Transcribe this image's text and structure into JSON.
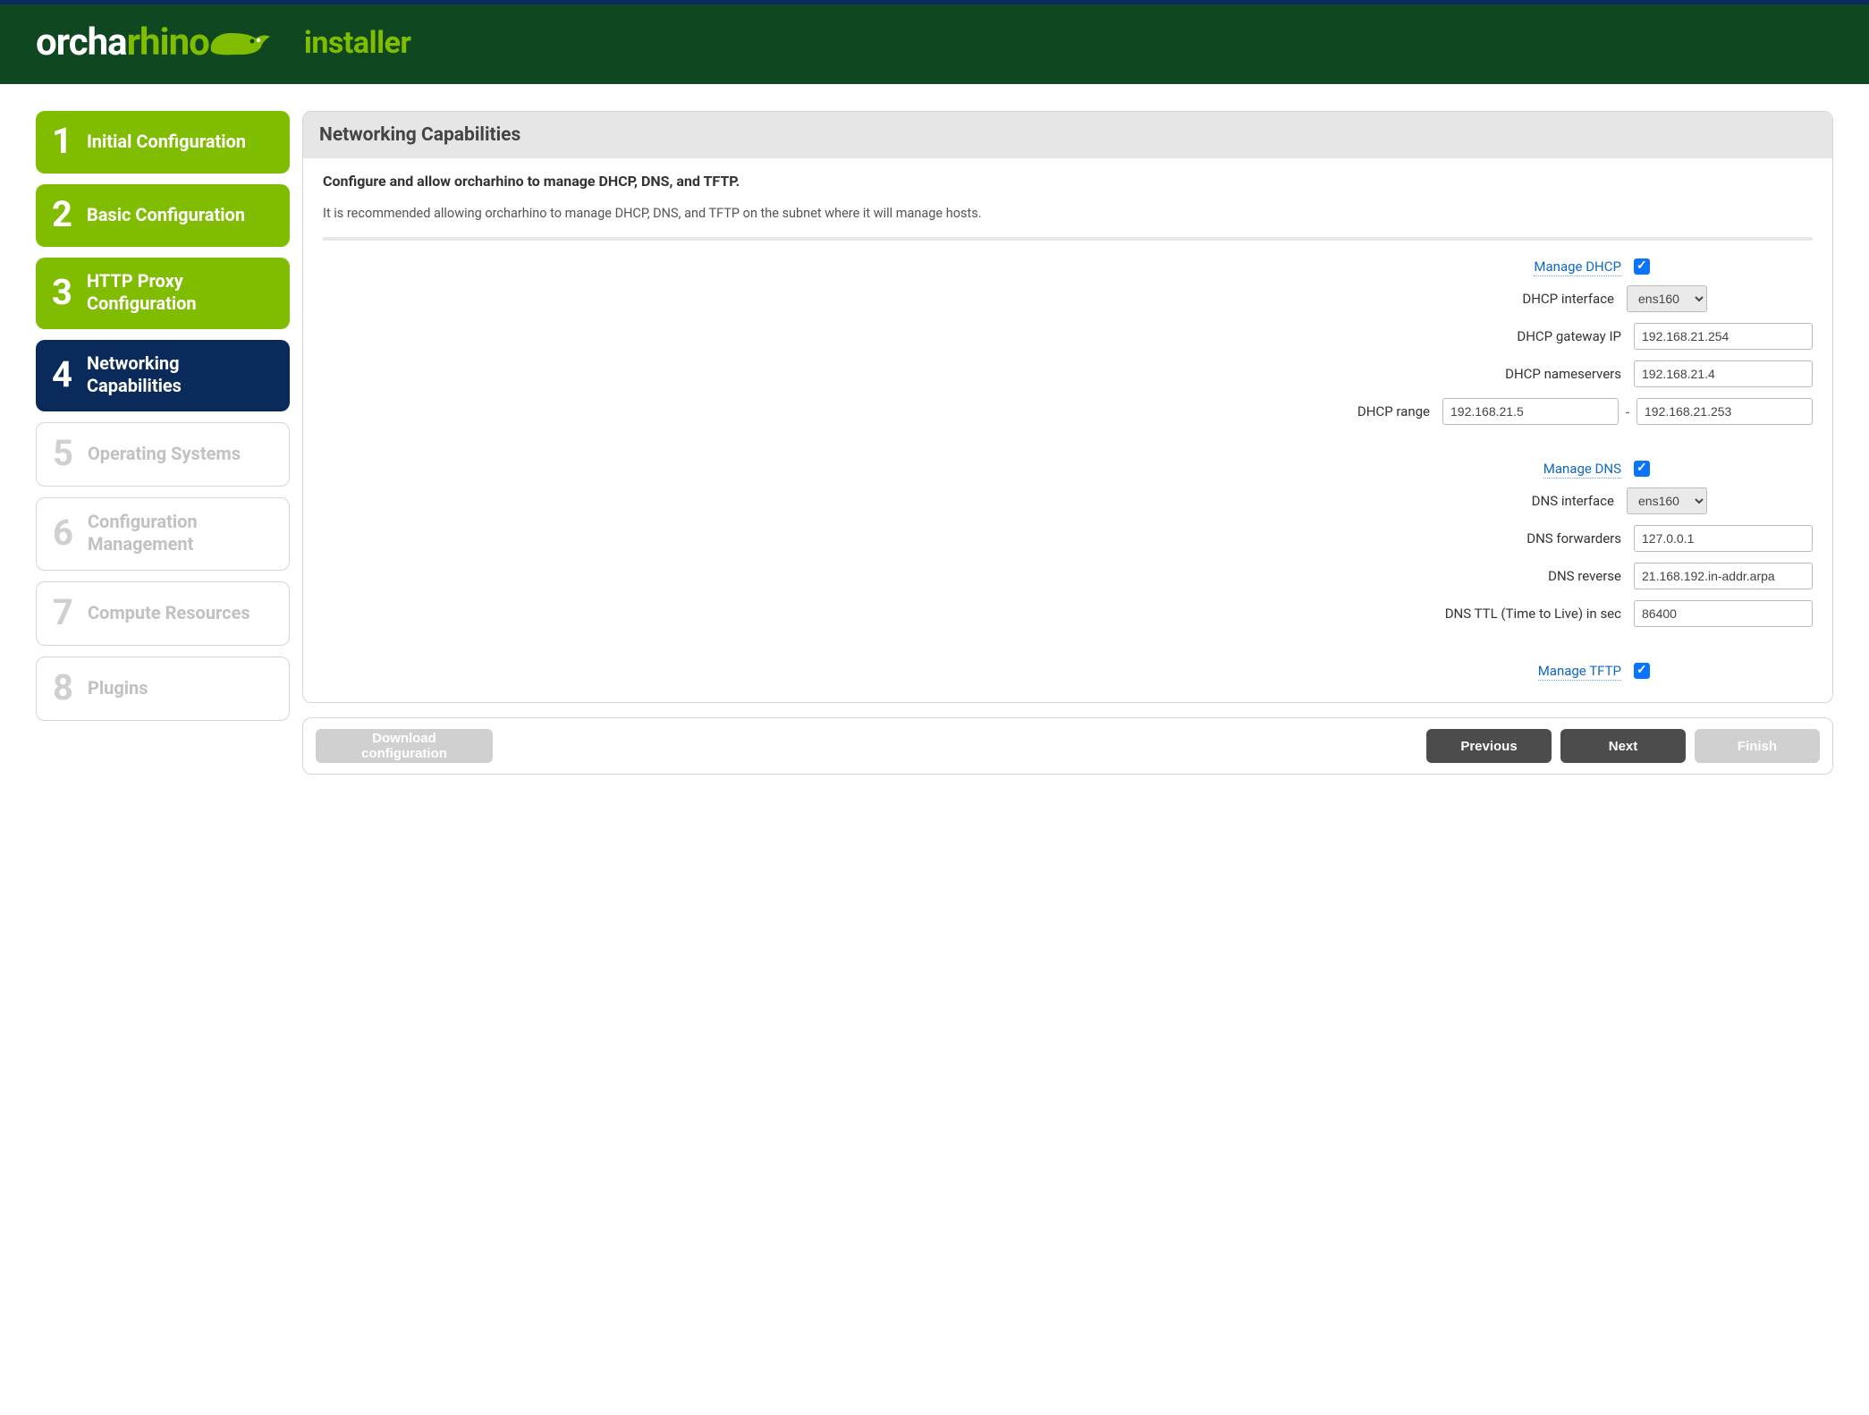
{
  "brand": {
    "part1": "orcha",
    "part2": "rhino",
    "subtitle": "installer"
  },
  "sidebar": {
    "items": [
      {
        "num": "1",
        "label": "Initial Configuration",
        "state": "done"
      },
      {
        "num": "2",
        "label": "Basic Configuration",
        "state": "done"
      },
      {
        "num": "3",
        "label": "HTTP Proxy Configuration",
        "state": "done"
      },
      {
        "num": "4",
        "label": "Networking Capabilities",
        "state": "current"
      },
      {
        "num": "5",
        "label": "Operating Systems",
        "state": "future"
      },
      {
        "num": "6",
        "label": "Configuration Management",
        "state": "future"
      },
      {
        "num": "7",
        "label": "Compute Resources",
        "state": "future"
      },
      {
        "num": "8",
        "label": "Plugins",
        "state": "future"
      }
    ]
  },
  "panel": {
    "title": "Networking Capabilities",
    "lead": "Configure and allow orcharhino to manage DHCP, DNS, and TFTP.",
    "help": "It is recommended allowing orcharhino to manage DHCP, DNS, and TFTP on the subnet where it will manage hosts."
  },
  "labels": {
    "manage_dhcp": "Manage DHCP",
    "dhcp_interface": "DHCP interface",
    "dhcp_gateway": "DHCP gateway IP",
    "dhcp_nameservers": "DHCP nameservers",
    "dhcp_range": "DHCP range",
    "range_sep": "-",
    "manage_dns": "Manage DNS",
    "dns_interface": "DNS interface",
    "dns_forwarders": "DNS forwarders",
    "dns_reverse": "DNS reverse",
    "dns_ttl": "DNS TTL (Time to Live) in sec",
    "manage_tftp": "Manage TFTP"
  },
  "values": {
    "manage_dhcp": true,
    "dhcp_interface": "ens160",
    "dhcp_gateway": "192.168.21.254",
    "dhcp_nameservers": "192.168.21.4",
    "dhcp_range_start": "192.168.21.5",
    "dhcp_range_end": "192.168.21.253",
    "manage_dns": true,
    "dns_interface": "ens160",
    "dns_forwarders": "127.0.0.1",
    "dns_reverse": "21.168.192.in-addr.arpa",
    "dns_ttl": "86400",
    "manage_tftp": true
  },
  "options": {
    "interfaces": [
      "ens160"
    ]
  },
  "footer": {
    "download": "Download configuration",
    "previous": "Previous",
    "next": "Next",
    "finish": "Finish"
  }
}
